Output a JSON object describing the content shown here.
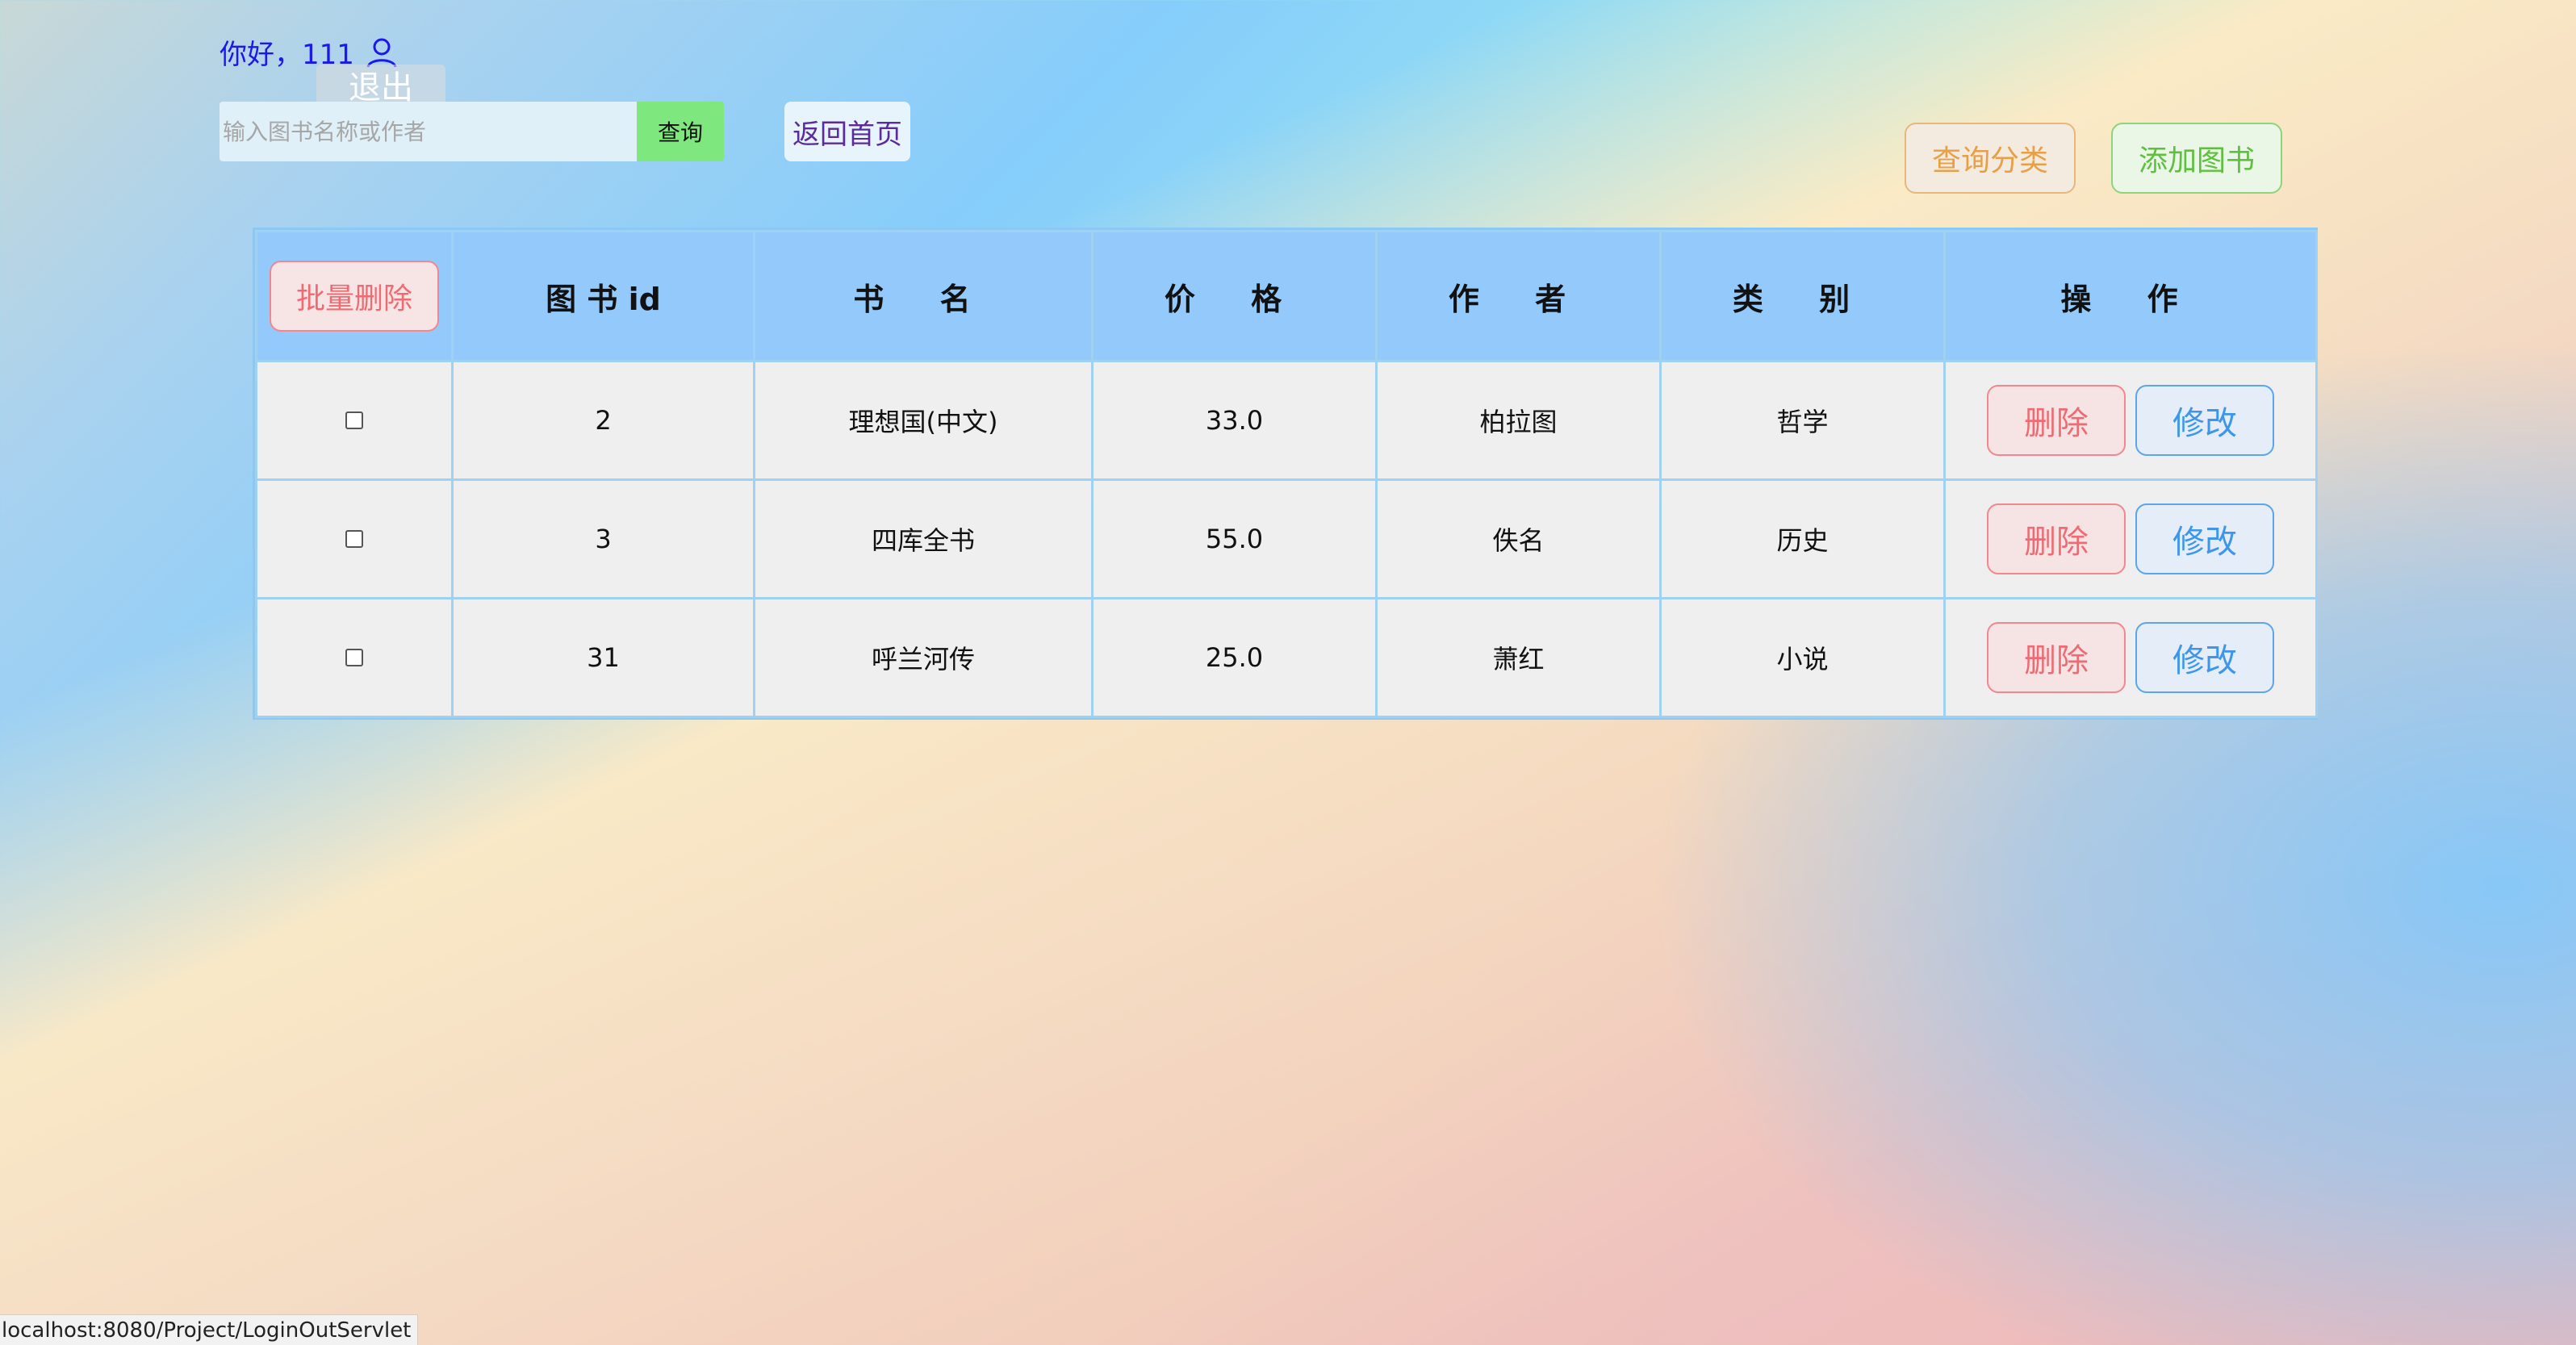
{
  "header": {
    "greeting": "你好，111",
    "logout_label": "退出"
  },
  "search": {
    "placeholder": "输入图书名称或作者",
    "value": "",
    "button_label": "查询"
  },
  "nav": {
    "home_label": "返回首页"
  },
  "actions": {
    "category_label": "查询分类",
    "add_book_label": "添加图书"
  },
  "table": {
    "batch_delete_label": "批量删除",
    "headers": [
      "图 书 id",
      "书 名",
      "价 格",
      "作 者",
      "类 别",
      "操 作"
    ],
    "rows": [
      {
        "id": "2",
        "name": "理想国(中文)",
        "price": "33.0",
        "author": "柏拉图",
        "category": "哲学"
      },
      {
        "id": "3",
        "name": "四库全书",
        "price": "55.0",
        "author": "佚名",
        "category": "历史"
      },
      {
        "id": "31",
        "name": "呼兰河传",
        "price": "25.0",
        "author": "萧红",
        "category": "小说"
      }
    ],
    "delete_label": "删除",
    "edit_label": "修改"
  },
  "status_bar": {
    "url": "localhost:8080/Project/LoginOutServlet"
  },
  "icons": {
    "user": "user-icon"
  },
  "colors": {
    "greeting": "#1a18ee",
    "header_bg": "#94c9fb",
    "delete_accent": "#ef6b74",
    "edit_accent": "#3d96ec",
    "category_accent": "#e7a047",
    "add_accent": "#5fbf3e",
    "search_button": "#7ee77d"
  }
}
